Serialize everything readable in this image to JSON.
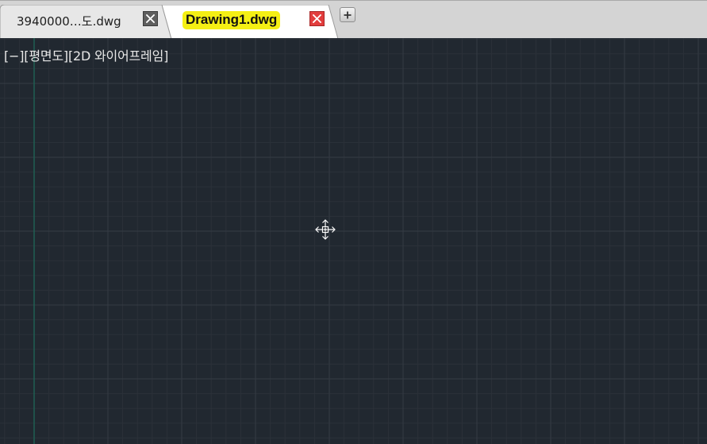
{
  "tabs": [
    {
      "label": "3940000…도.dwg",
      "active": false
    },
    {
      "label": "Drawing1.dwg",
      "active": true
    }
  ],
  "viewport": {
    "control_bracket": "[−]",
    "view_bracket": "[평면도]",
    "style_bracket": "[2D 와이어프레임]"
  },
  "icons": {
    "close": "close-icon",
    "new_tab": "plus-icon",
    "cursor": "move-cursor-icon"
  },
  "colors": {
    "canvas": "#212830",
    "tab_highlight": "#f4ef14",
    "active_close": "#e23d3d",
    "inactive_close": "#5e5e5e",
    "tabbar": "#d4d4d4"
  }
}
